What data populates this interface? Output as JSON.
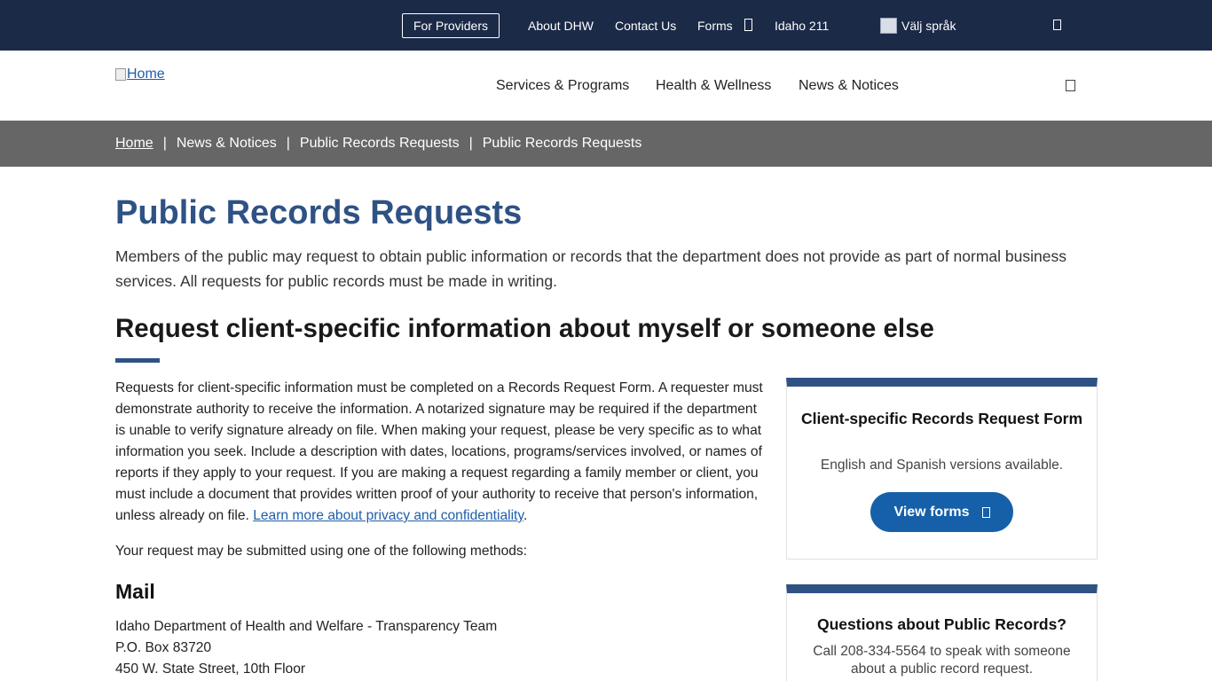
{
  "topbar": {
    "providers_label": "For Providers",
    "about_label": "About DHW",
    "contact_label": "Contact Us",
    "forms_label": "Forms",
    "idaho211_label": "Idaho 211",
    "language_label": "Välj språk"
  },
  "header": {
    "logo_alt": "Home",
    "nav": {
      "services": "Services & Programs",
      "health": "Health & Wellness",
      "news": "News & Notices"
    }
  },
  "breadcrumb": {
    "home": "Home",
    "sep": "|",
    "items": [
      "News & Notices",
      "Public Records Requests",
      "Public Records Requests"
    ]
  },
  "main": {
    "title": "Public Records Requests",
    "intro": "Members of the public may request to obtain public information or records that the department does not provide as part of normal business services. All requests for public records must be made in writing.",
    "section_heading": "Request client-specific information about myself or someone else",
    "body": "Requests for client-specific information must be completed on a Records Request Form. A requester must demonstrate authority to receive the information. A notarized signature may be required if the department is unable to verify signature already on file. When making your request, please be very specific as to what information you seek. Include a description with dates, locations, programs/services involved, or names of reports if they apply to your request. If you are making a request regarding a family member or client, you must include a document that provides written proof of your authority to receive that person's information, unless already on file.",
    "privacy_link": "Learn more about privacy and confidentiality",
    "period": ".",
    "methods_intro": "Your request may be submitted using one of the following methods:",
    "mail_heading": "Mail",
    "mail_lines": [
      "Idaho Department of Health and Welfare - Transparency Team",
      "P.O. Box 83720",
      "450 W. State Street, 10th Floor"
    ]
  },
  "sidebar": {
    "card1": {
      "title": "Client-specific Records Request Form",
      "subtitle": "English and Spanish versions available.",
      "button": "View forms"
    },
    "card2": {
      "title": "Questions about Public Records?",
      "subtitle": "Call 208-334-5564 to speak with someone about a public record request."
    }
  },
  "colors": {
    "topbar_bg": "#1b2a47",
    "breadcrumb_bg": "#666666",
    "accent": "#2f5284",
    "button_bg": "#1560a9",
    "link": "#1f5ea8"
  },
  "icons": {
    "forms_caret": "chevron-down-icon",
    "top_search": "search-icon",
    "main_menu": "menu-icon",
    "view_forms_external": "external-link-icon",
    "language_flag": "flag-icon"
  }
}
